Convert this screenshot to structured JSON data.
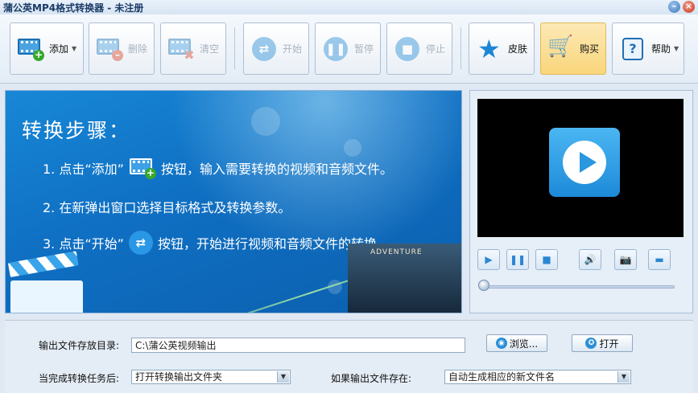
{
  "window": {
    "title": "蒲公英MP4格式转换器 - 未注册",
    "minimize_glyph": "–",
    "close_glyph": "×"
  },
  "toolbar": {
    "add_label": "添加",
    "delete_label": "删除",
    "clear_label": "清空",
    "start_label": "开始",
    "pause_label": "暂停",
    "stop_label": "停止",
    "skin_label": "皮肤",
    "buy_label": "购买",
    "help_label": "帮助",
    "icons": {
      "add": "film-add-icon",
      "delete": "film-delete-icon",
      "clear": "film-clear-icon",
      "start": "shuffle-icon",
      "pause": "pause-icon",
      "stop": "stop-icon",
      "skin": "star-icon",
      "buy": "cart-icon",
      "help": "help-icon"
    }
  },
  "banner": {
    "title": "转换步骤：",
    "step1_before": "1. 点击“添加”",
    "step1_after": "按钮，输入需要转换的视频和音频文件。",
    "step2": "2. 在新弹出窗口选择目标格式及转换参数。",
    "step3_before": "3. 点击“开始”",
    "step3_after": "按钮，开始进行视频和音频文件的转换。",
    "poster_title": "ADVENTURE"
  },
  "player": {
    "progress": 0.0
  },
  "settings": {
    "output_dir_label": "输出文件存放目录:",
    "output_dir_value": "C:\\蒲公英视频输出",
    "browse_label": "浏览...",
    "open_label": "打开",
    "after_done_label": "当完成转换任务后:",
    "after_done_value": "打开转换输出文件夹",
    "if_exists_label": "如果输出文件存在:",
    "if_exists_value": "自动生成相应的新文件名"
  },
  "colors": {
    "accent": "#1e86d4",
    "highlight": "#f9d67b",
    "banner": "#0f6fc2"
  }
}
